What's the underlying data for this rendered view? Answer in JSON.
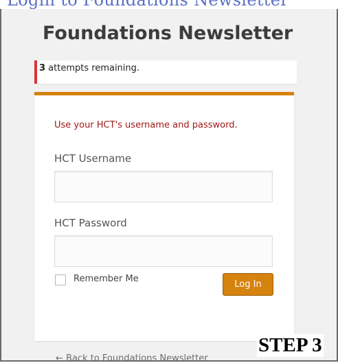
{
  "login": {
    "site_title": "Foundations Newsletter",
    "notice": {
      "count": "3",
      "text": " attempts remaining."
    },
    "hint": "Use your HCT's username and password.",
    "username_label": "HCT Username",
    "username_value": "",
    "password_label": "HCT Password",
    "password_value": "",
    "remember_label": "Remember Me",
    "submit_label": "Log In",
    "back_link": "← Back to Foundations Newsletter"
  },
  "overlay": {
    "step_label": "STEP 3"
  },
  "colors": {
    "accent": "#d5820e",
    "error": "#d63638",
    "hint": "#a01818",
    "background": "#f1f1f1"
  }
}
